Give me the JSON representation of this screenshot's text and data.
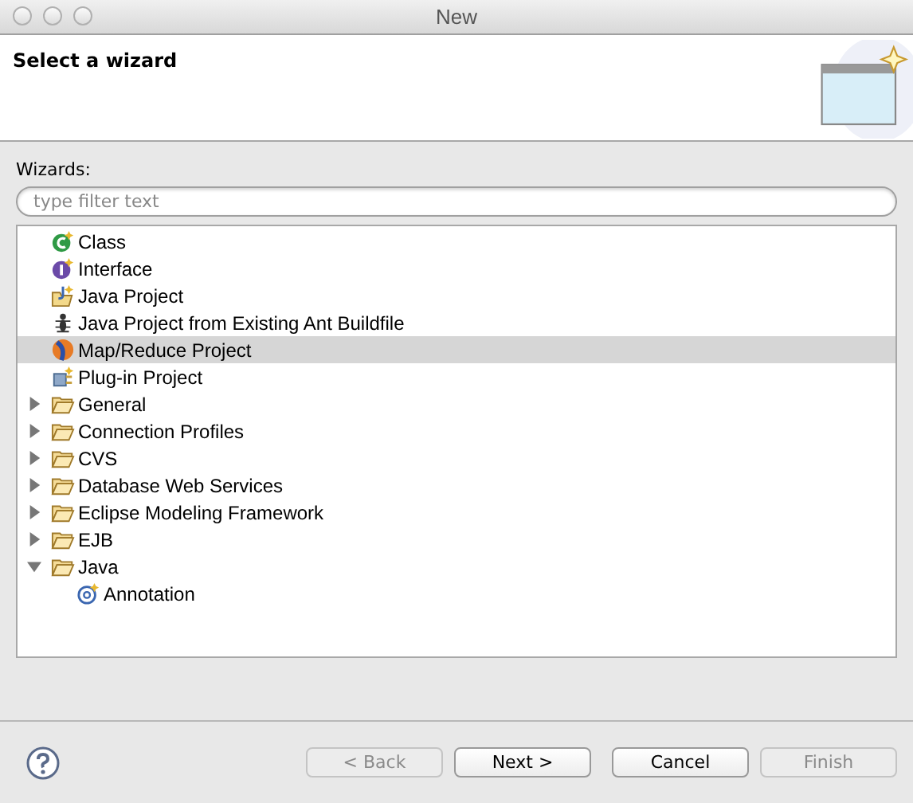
{
  "window": {
    "title": "New"
  },
  "header": {
    "title": "Select a wizard"
  },
  "wizards_label": "Wizards:",
  "filter": {
    "placeholder": "type filter text"
  },
  "tree": [
    {
      "label": "Class",
      "kind": "class",
      "selected": false
    },
    {
      "label": "Interface",
      "kind": "interface",
      "selected": false
    },
    {
      "label": "Java Project",
      "kind": "project",
      "selected": false
    },
    {
      "label": "Java Project from Existing Ant Buildfile",
      "kind": "ant",
      "selected": false
    },
    {
      "label": "Map/Reduce Project",
      "kind": "mapreduce",
      "selected": true
    },
    {
      "label": "Plug-in Project",
      "kind": "plugin",
      "selected": false
    },
    {
      "label": "General",
      "kind": "folder",
      "selected": false,
      "expanded": false
    },
    {
      "label": "Connection Profiles",
      "kind": "folder",
      "selected": false,
      "expanded": false
    },
    {
      "label": "CVS",
      "kind": "folder",
      "selected": false,
      "expanded": false
    },
    {
      "label": "Database Web Services",
      "kind": "folder",
      "selected": false,
      "expanded": false
    },
    {
      "label": "Eclipse Modeling Framework",
      "kind": "folder",
      "selected": false,
      "expanded": false
    },
    {
      "label": "EJB",
      "kind": "folder",
      "selected": false,
      "expanded": false
    },
    {
      "label": "Java",
      "kind": "folder",
      "selected": false,
      "expanded": true,
      "children": [
        {
          "label": "Annotation",
          "kind": "annotation",
          "selected": false
        }
      ]
    }
  ],
  "buttons": [
    {
      "label": "< Back",
      "disabled": true
    },
    {
      "label": "Next >",
      "disabled": false
    },
    {
      "label": "Cancel",
      "disabled": false
    },
    {
      "label": "Finish",
      "disabled": true
    }
  ]
}
